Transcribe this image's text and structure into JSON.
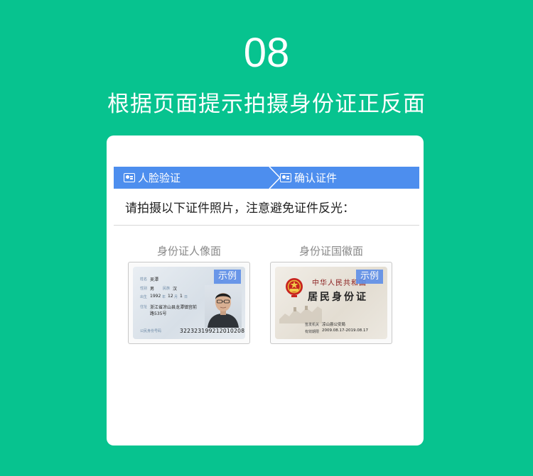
{
  "header": {
    "step_number": "08",
    "title": "根据页面提示拍摄身份证正反面"
  },
  "app": {
    "steps": [
      {
        "label": "人脸验证",
        "icon": "id-card-icon"
      },
      {
        "label": "确认证件",
        "icon": "id-card-icon"
      }
    ],
    "instruction": "请拍摄以下证件照片，注意避免证件反光：",
    "cards": [
      {
        "label": "身份证人像面",
        "tag": "示例",
        "fields": {
          "name_label": "姓名",
          "name": "吴潭",
          "sex_label": "性别",
          "sex": "男",
          "ethnic_label": "民族",
          "ethnic": "汉",
          "birth_label": "出生",
          "birth_year": "1992",
          "year_unit": "年",
          "birth_month": "12",
          "month_unit": "月",
          "birth_day": "1",
          "day_unit": "日",
          "address_label": "住址",
          "address_line1": "浙江省凉山县龙潭镇宫前",
          "address_line2": "路535号",
          "id_label": "公民身份号码",
          "id_number": "322323199212010208"
        }
      },
      {
        "label": "身份证国徽面",
        "tag": "示例",
        "fields": {
          "country": "中华人民共和国",
          "card_type": "居民身份证",
          "authority_label": "签发机关",
          "authority": "凉山县公安局",
          "validity_label": "有效期限",
          "validity": "2009.08.17-2019.08.17"
        }
      }
    ]
  },
  "colors": {
    "background": "#07c38f",
    "steps_bar": "#4d8eee",
    "sample_tag": "#5d8ee8"
  }
}
